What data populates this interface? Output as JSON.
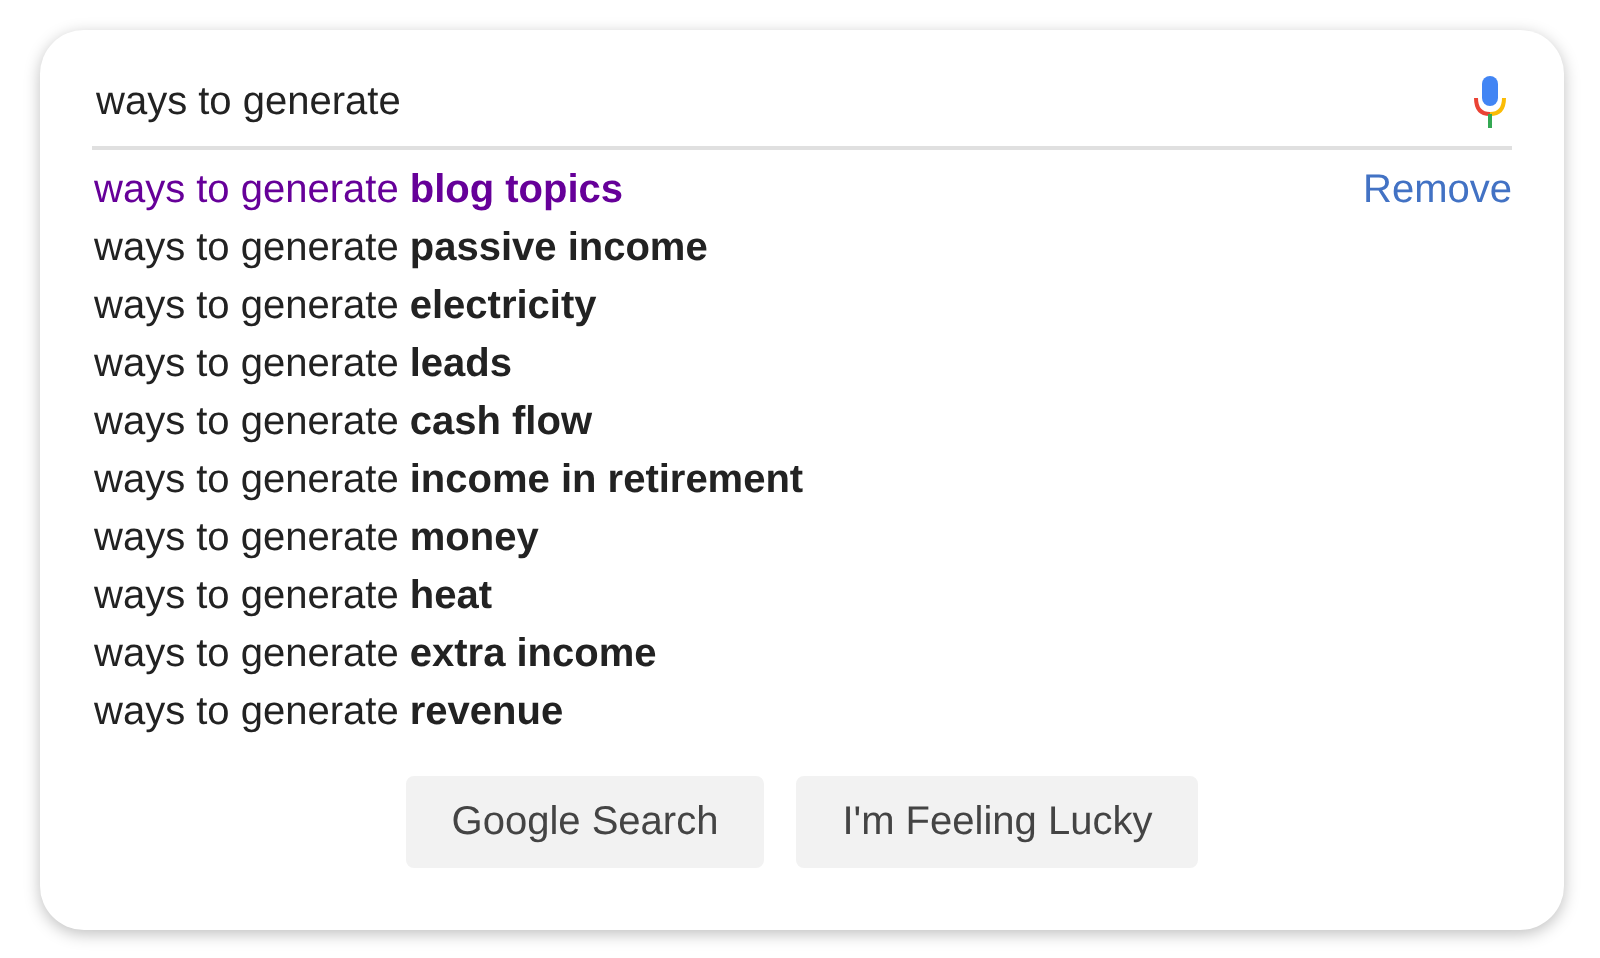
{
  "search": {
    "value": "ways to generate"
  },
  "suggestions": [
    {
      "text": "ways to generate **blog topics**",
      "visited": true,
      "remove": "Remove"
    },
    {
      "text": "ways to generate **passive income**",
      "visited": false
    },
    {
      "text": "ways to generate **electricity**",
      "visited": false
    },
    {
      "text": "ways to generate **leads**",
      "visited": false
    },
    {
      "text": "ways to generate **cash flow**",
      "visited": false
    },
    {
      "text": "ways to generate **income in retirement**",
      "visited": false
    },
    {
      "text": "ways to generate **money**",
      "visited": false
    },
    {
      "text": "ways to generate **heat**",
      "visited": false
    },
    {
      "text": "ways to generate **extra income**",
      "visited": false
    },
    {
      "text": "ways to generate **revenue**",
      "visited": false
    }
  ],
  "buttons": [
    "Google Search",
    "I'm Feeling Lucky"
  ]
}
